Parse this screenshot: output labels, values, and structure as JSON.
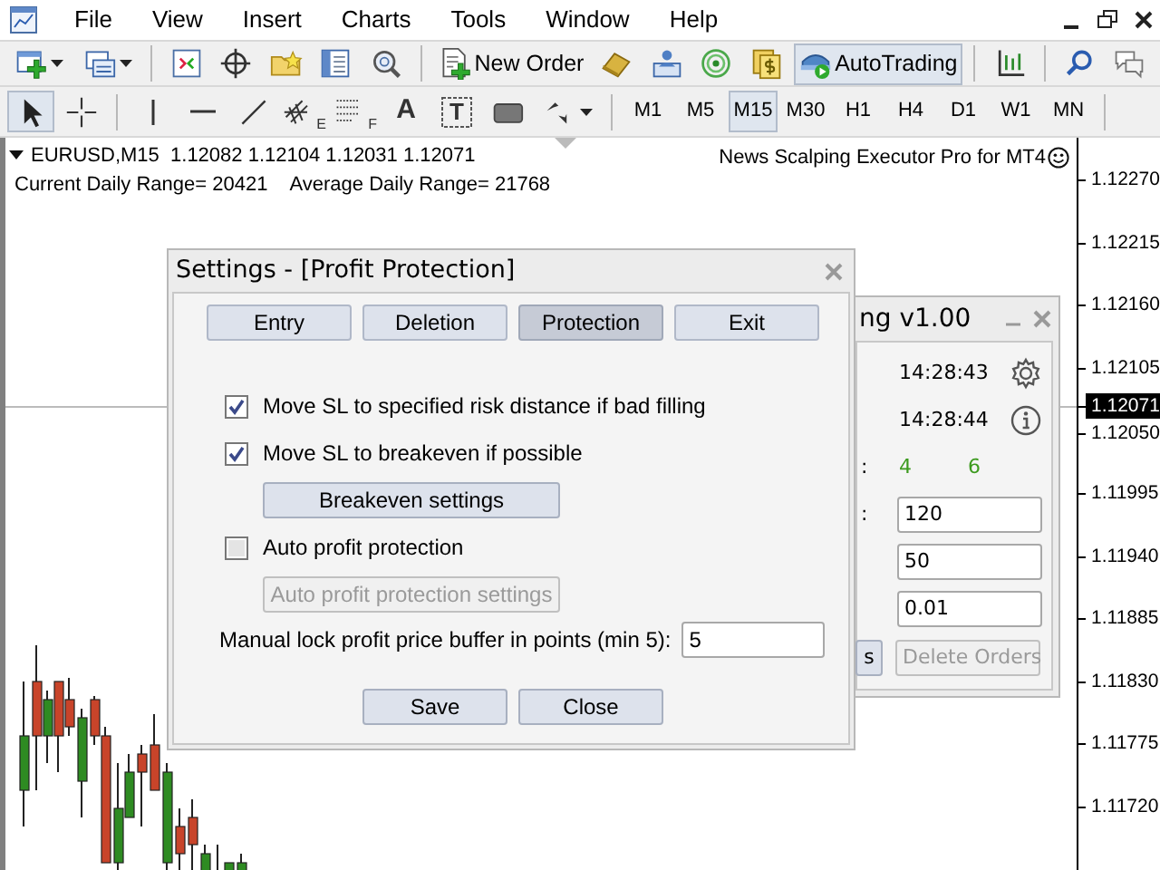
{
  "menu_bar": {
    "items": [
      "File",
      "View",
      "Insert",
      "Charts",
      "Tools",
      "Window",
      "Help"
    ]
  },
  "standard_toolbar": {
    "groups": [
      [
        {
          "kind": "new-chart",
          "dropdown": true
        },
        {
          "kind": "profiles",
          "dropdown": true
        }
      ],
      [
        {
          "kind": "chart-window"
        },
        {
          "kind": "target"
        },
        {
          "kind": "favorites"
        },
        {
          "kind": "navigator"
        },
        {
          "kind": "tester"
        }
      ],
      [
        {
          "kind": "new-order",
          "label": "New Order"
        },
        {
          "kind": "gold"
        },
        {
          "kind": "terminal"
        },
        {
          "kind": "signal"
        },
        {
          "kind": "coins"
        },
        {
          "kind": "autotrading",
          "label": "AutoTrading",
          "on": true
        }
      ],
      [
        {
          "kind": "axes"
        }
      ],
      [
        {
          "kind": "search"
        },
        {
          "kind": "chat"
        }
      ]
    ]
  },
  "drawing_toolbar": {
    "groups": [
      [
        {
          "kind": "cursor",
          "selected": true
        },
        {
          "kind": "crosshair",
          "selected": false
        }
      ],
      [
        {
          "kind": "vline",
          "selected": false
        },
        {
          "kind": "hline",
          "selected": false
        },
        {
          "kind": "trendline",
          "selected": false
        },
        {
          "kind": "channel",
          "sub": "E",
          "selected": false
        },
        {
          "kind": "fibo",
          "sub": "F",
          "selected": false
        },
        {
          "kind": "text",
          "label": "A",
          "selected": false
        },
        {
          "kind": "label",
          "label": "T",
          "selected": false
        },
        {
          "kind": "rectangle",
          "selected": false
        },
        {
          "kind": "arrows",
          "dropdown": true,
          "selected": false
        }
      ]
    ]
  },
  "timeframes": [
    {
      "label": "M1",
      "selected": false
    },
    {
      "label": "M5",
      "selected": false
    },
    {
      "label": "M15",
      "selected": true
    },
    {
      "label": "M30",
      "selected": false
    },
    {
      "label": "H1",
      "selected": false
    },
    {
      "label": "H4",
      "selected": false
    },
    {
      "label": "D1",
      "selected": false
    },
    {
      "label": "W1",
      "selected": false
    },
    {
      "label": "MN",
      "selected": false
    }
  ],
  "chart": {
    "symbol_info": "EURUSD,M15  1.12082 1.12104 1.12031 1.12071",
    "current_range": "Current Daily Range= 20421",
    "average_range": "Average Daily Range= 21768",
    "expert_name": "News Scalping Executor Pro for MT4",
    "price_labels": [
      {
        "text": "1.12270",
        "kind": "tick"
      },
      {
        "text": "1.12215",
        "kind": "tick"
      },
      {
        "text": "1.12160",
        "kind": "tick"
      },
      {
        "text": "1.12105",
        "kind": "tick"
      },
      {
        "text": "1.12071",
        "kind": "current"
      },
      {
        "text": "1.12050",
        "kind": "tick"
      },
      {
        "text": "1.11995",
        "kind": "tick"
      },
      {
        "text": "1.11940",
        "kind": "tick"
      },
      {
        "text": "1.11885",
        "kind": "tick"
      },
      {
        "text": "1.11830",
        "kind": "tick"
      },
      {
        "text": "1.11775",
        "kind": "tick"
      },
      {
        "text": "1.11720",
        "kind": "tick"
      }
    ]
  },
  "ea_panel": {
    "title": "ng v1.00",
    "rows": [
      {
        "kind": "time",
        "text": "14:28:43"
      },
      {
        "kind": "time",
        "text": "14:28:44"
      },
      {
        "kind": "counts",
        "label": ":",
        "values": [
          "4",
          "6"
        ]
      },
      {
        "kind": "field",
        "label": ":",
        "value": "120"
      },
      {
        "kind": "field",
        "value": "50"
      },
      {
        "kind": "field",
        "value": "0.01"
      }
    ],
    "buttons": [
      {
        "label": "s",
        "disabled": false
      },
      {
        "label": "Delete Orders",
        "disabled": true
      }
    ]
  },
  "settings_dialog": {
    "title": "Settings - [Profit Protection]",
    "tabs": [
      {
        "label": "Entry",
        "selected": false
      },
      {
        "label": "Deletion",
        "selected": false
      },
      {
        "label": "Protection",
        "selected": true
      },
      {
        "label": "Exit",
        "selected": false
      }
    ],
    "options": [
      {
        "kind": "checkbox",
        "label": "Move SL to specified risk distance if bad filling",
        "checked": true
      },
      {
        "kind": "checkbox",
        "label": "Move SL to breakeven if possible",
        "checked": true
      },
      {
        "kind": "button",
        "label": "Breakeven settings",
        "disabled": false
      },
      {
        "kind": "checkbox",
        "label": "Auto profit protection",
        "checked": false
      },
      {
        "kind": "button",
        "label": "Auto profit protection settings",
        "disabled": true
      },
      {
        "kind": "field",
        "label": "Manual lock profit price buffer in points (min 5):",
        "value": "5"
      }
    ],
    "buttons": [
      "Save",
      "Close"
    ]
  }
}
